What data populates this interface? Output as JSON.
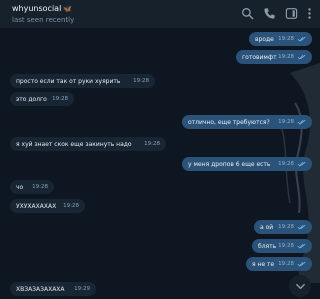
{
  "header": {
    "title": "whyunsocial",
    "title_emoji": "🦋",
    "status": "last seen recently",
    "icons": [
      "search-icon",
      "phone-icon",
      "sidebar-icon",
      "more-icon"
    ]
  },
  "messages": [
    {
      "dir": "out",
      "text": "вроде",
      "time": "19:28"
    },
    {
      "dir": "out",
      "text": "готовимфт",
      "time": "19:28"
    },
    {
      "dir": "in",
      "text": "просто если так от руки хуярить",
      "time": "19:28"
    },
    {
      "dir": "in",
      "text": "это долго",
      "time": "19:28"
    },
    {
      "dir": "out",
      "text": "отлично, еще требуются?",
      "time": "19:28"
    },
    {
      "dir": "in",
      "text": "я хуй знает скок еще закинуть надо",
      "time": "19:28"
    },
    {
      "dir": "out",
      "text": "у меня дропов 6 еще есть",
      "time": "19:28"
    },
    {
      "dir": "in",
      "text": "чо",
      "time": "19:28"
    },
    {
      "dir": "in",
      "text": "УХУХАХАХАХ",
      "time": "19:28"
    },
    {
      "dir": "out",
      "text": "а ой",
      "time": "19:28"
    },
    {
      "dir": "out",
      "text": "блять",
      "time": "19:28"
    },
    {
      "dir": "out",
      "text": "я не те",
      "time": "19:28"
    },
    {
      "dir": "in",
      "text": "ХВЗАЗАЗАХАХА",
      "time": "19:29"
    }
  ],
  "colors": {
    "chat_bg": "#0e1621",
    "header_bg": "#17212b",
    "incoming_bubble": "#182533",
    "outgoing_bubble": "#2b5278",
    "check_color": "#6ab2f2"
  }
}
